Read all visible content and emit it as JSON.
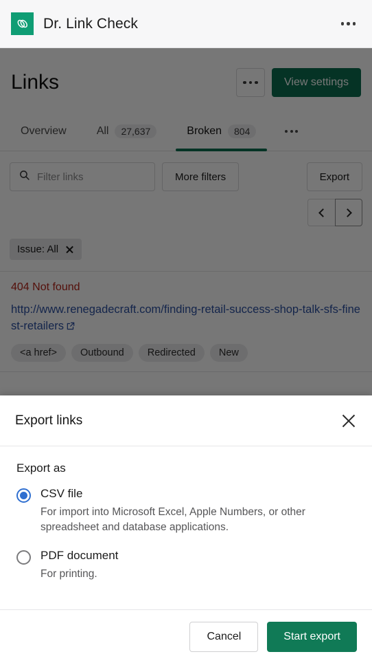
{
  "appbar": {
    "logo_icon": "chain-link-icon",
    "logo_color": "#0f9d74",
    "title": "Dr. Link Check",
    "menu_icon": "overflow-menu-icon"
  },
  "page": {
    "title": "Links",
    "overflow_icon": "overflow-menu-icon",
    "view_settings_label": "View settings",
    "primary_color": "#0b6e4f",
    "tabs": [
      {
        "label": "Overview",
        "count": null,
        "active": false
      },
      {
        "label": "All",
        "count": "27,637",
        "active": false
      },
      {
        "label": "Broken",
        "count": "804",
        "active": true
      }
    ],
    "tabs_overflow_icon": "overflow-menu-icon",
    "filters": {
      "search_placeholder": "Filter links",
      "search_value": "",
      "search_icon": "search-icon",
      "more_filters_label": "More filters",
      "export_label": "Export"
    },
    "pagination": {
      "prev_icon": "chevron-left-icon",
      "next_icon": "chevron-right-icon"
    },
    "active_chips": [
      {
        "label": "Issue: All",
        "remove_icon": "close-icon"
      }
    ],
    "results": [
      {
        "status": "404 Not found",
        "status_color": "#b42318",
        "url": "http://www.renegadecraft.com/finding-retail-success-shop-talk-sfs-finest-retailers",
        "url_color": "#2b4fa2",
        "external_icon": "external-link-icon",
        "tags": [
          "<a href>",
          "Outbound",
          "Redirected",
          "New"
        ]
      }
    ]
  },
  "modal": {
    "title": "Export links",
    "close_icon": "close-icon",
    "section_label": "Export as",
    "options": [
      {
        "label": "CSV file",
        "description": "For import into Microsoft Excel, Apple Numbers, or other spreadsheet and database applications.",
        "selected": true
      },
      {
        "label": "PDF document",
        "description": "For printing.",
        "selected": false
      }
    ],
    "selected_color": "#2f6fd0",
    "cancel_label": "Cancel",
    "start_label": "Start export",
    "start_color": "#107a56"
  }
}
